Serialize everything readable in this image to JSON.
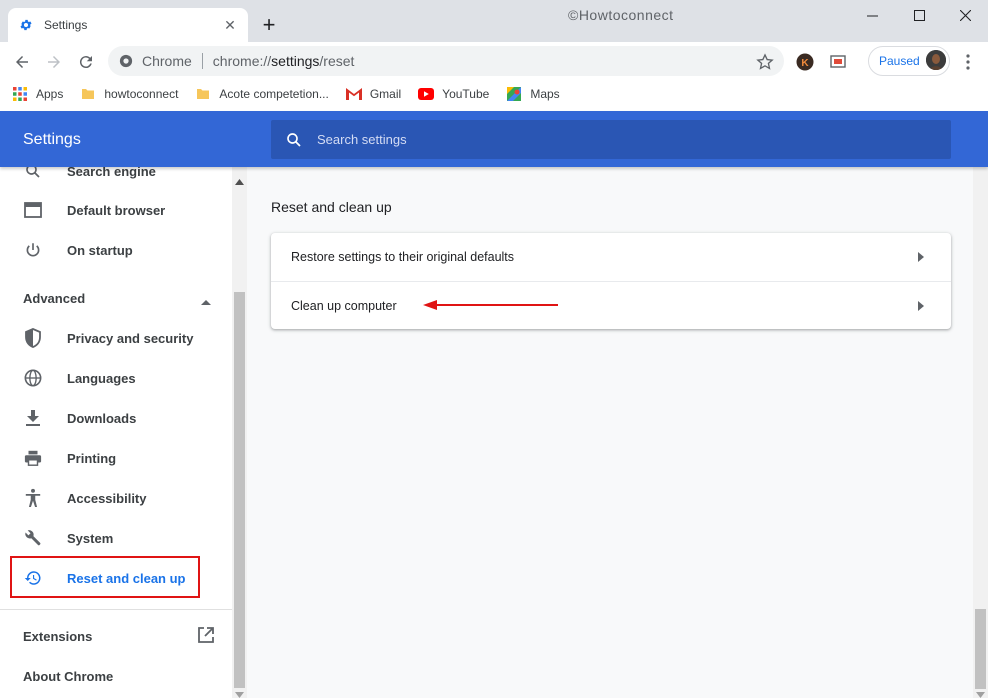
{
  "window": {
    "tab_title": "Settings",
    "watermark": "©Howtoconnect"
  },
  "toolbar": {
    "site_name": "Chrome",
    "url_prefix": "chrome://",
    "url_host": "settings",
    "url_path": "/reset",
    "profile_status": "Paused",
    "extension_letter": "K"
  },
  "bookmarks": [
    {
      "label": "Apps",
      "icon": "apps-grid-icon"
    },
    {
      "label": "howtoconnect",
      "icon": "folder-icon"
    },
    {
      "label": "Acote competetion...",
      "icon": "folder-icon"
    },
    {
      "label": "Gmail",
      "icon": "gmail-icon"
    },
    {
      "label": "YouTube",
      "icon": "youtube-icon"
    },
    {
      "label": "Maps",
      "icon": "maps-icon"
    }
  ],
  "header": {
    "title": "Settings",
    "search_placeholder": "Search settings"
  },
  "sidebar": {
    "items_top": [
      {
        "label": "Search engine",
        "icon": "search-icon"
      },
      {
        "label": "Default browser",
        "icon": "browser-icon"
      },
      {
        "label": "On startup",
        "icon": "power-icon"
      }
    ],
    "advanced_label": "Advanced",
    "items_advanced": [
      {
        "label": "Privacy and security",
        "icon": "shield-icon"
      },
      {
        "label": "Languages",
        "icon": "globe-icon"
      },
      {
        "label": "Downloads",
        "icon": "download-icon"
      },
      {
        "label": "Printing",
        "icon": "printer-icon"
      },
      {
        "label": "Accessibility",
        "icon": "accessibility-icon"
      },
      {
        "label": "System",
        "icon": "wrench-icon"
      },
      {
        "label": "Reset and clean up",
        "icon": "history-icon"
      }
    ],
    "extensions_label": "Extensions",
    "about_label": "About Chrome"
  },
  "main": {
    "section_title": "Reset and clean up",
    "rows": [
      {
        "label": "Restore settings to their original defaults"
      },
      {
        "label": "Clean up computer"
      }
    ]
  },
  "colors": {
    "header_blue": "#3367d6",
    "search_blue": "#2a56b4",
    "active_blue": "#1a73e8",
    "annotation_red": "#e01414"
  }
}
